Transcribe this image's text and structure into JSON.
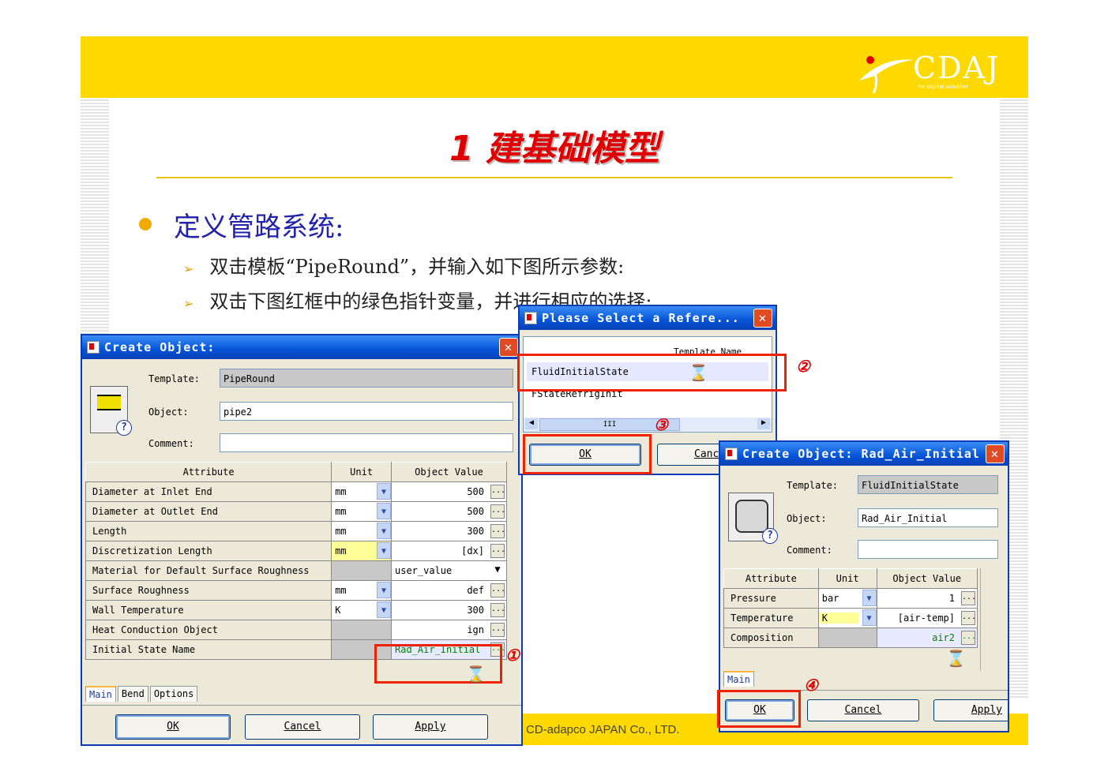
{
  "slide": {
    "logo_text": "CDAJ",
    "logo_sub": "for digital solution",
    "title": "1 建基础模型",
    "bullet": "定义管路系统:",
    "sub1": "双击模板“PipeRound”，并输入如下图所示参数:",
    "sub2": "双击下图红框中的绿色指针变量，并进行相应的选择:",
    "footer": "CD-adapco JAPAN Co., LTD."
  },
  "colors": {
    "accent_yellow": "#fdd900",
    "title_red": "#e00000",
    "bullet_blue": "#2222aa",
    "highlight_red": "#ee2200"
  },
  "win1": {
    "title": "Create Object:",
    "template_label": "Template:",
    "template_value": "PipeRound",
    "object_label": "Object:",
    "object_value": "pipe2",
    "comment_label": "Comment:",
    "comment_value": "",
    "headers": [
      "Attribute",
      "Unit",
      "Object Value"
    ],
    "rows": [
      {
        "attr": "Diameter at Inlet End",
        "unit": "mm",
        "value": "500"
      },
      {
        "attr": "Diameter at Outlet End",
        "unit": "mm",
        "value": "500"
      },
      {
        "attr": "Length",
        "unit": "mm",
        "value": "300"
      },
      {
        "attr": "Discretization Length",
        "unit": "mm",
        "value": "[dx]"
      },
      {
        "attr": "Material for Default Surface Roughness",
        "unit": "",
        "value": "user_value"
      },
      {
        "attr": "Surface Roughness",
        "unit": "mm",
        "value": "def"
      },
      {
        "attr": "Wall Temperature",
        "unit": "K",
        "value": "300"
      },
      {
        "attr": "Heat Conduction Object",
        "unit": "",
        "value": "ign"
      },
      {
        "attr": "Initial State Name",
        "unit": "",
        "value": "Rad_Air_Initial"
      }
    ],
    "tabs": [
      "Main",
      "Bend",
      "Options"
    ],
    "ok": "OK",
    "cancel": "Cancel",
    "apply": "Apply"
  },
  "win2": {
    "title": "Please Select a Refere...",
    "column": "Template Name",
    "items": [
      "FluidInitialState",
      "FStateRefrigInit"
    ],
    "scroll_thumb": "III",
    "ok": "OK",
    "cancel": "Canc"
  },
  "win3": {
    "title": "Create Object: Rad_Air_Initial",
    "template_label": "Template:",
    "template_value": "FluidInitialState",
    "object_label": "Object:",
    "object_value": "Rad_Air_Initial",
    "comment_label": "Comment:",
    "comment_value": "",
    "headers": [
      "Attribute",
      "Unit",
      "Object Value"
    ],
    "rows": [
      {
        "attr": "Pressure",
        "unit": "bar",
        "value": "1"
      },
      {
        "attr": "Temperature",
        "unit": "K",
        "value": "[air-temp]"
      },
      {
        "attr": "Composition",
        "unit": "",
        "value": "air2"
      }
    ],
    "tabs": [
      "Main"
    ],
    "ok": "OK",
    "cancel": "Cancel",
    "apply": "Apply"
  },
  "markers": [
    "①",
    "②",
    "③",
    "④"
  ],
  "ellipsis": "...",
  "hourglass": "⌛",
  "close": "✕",
  "help": "?"
}
